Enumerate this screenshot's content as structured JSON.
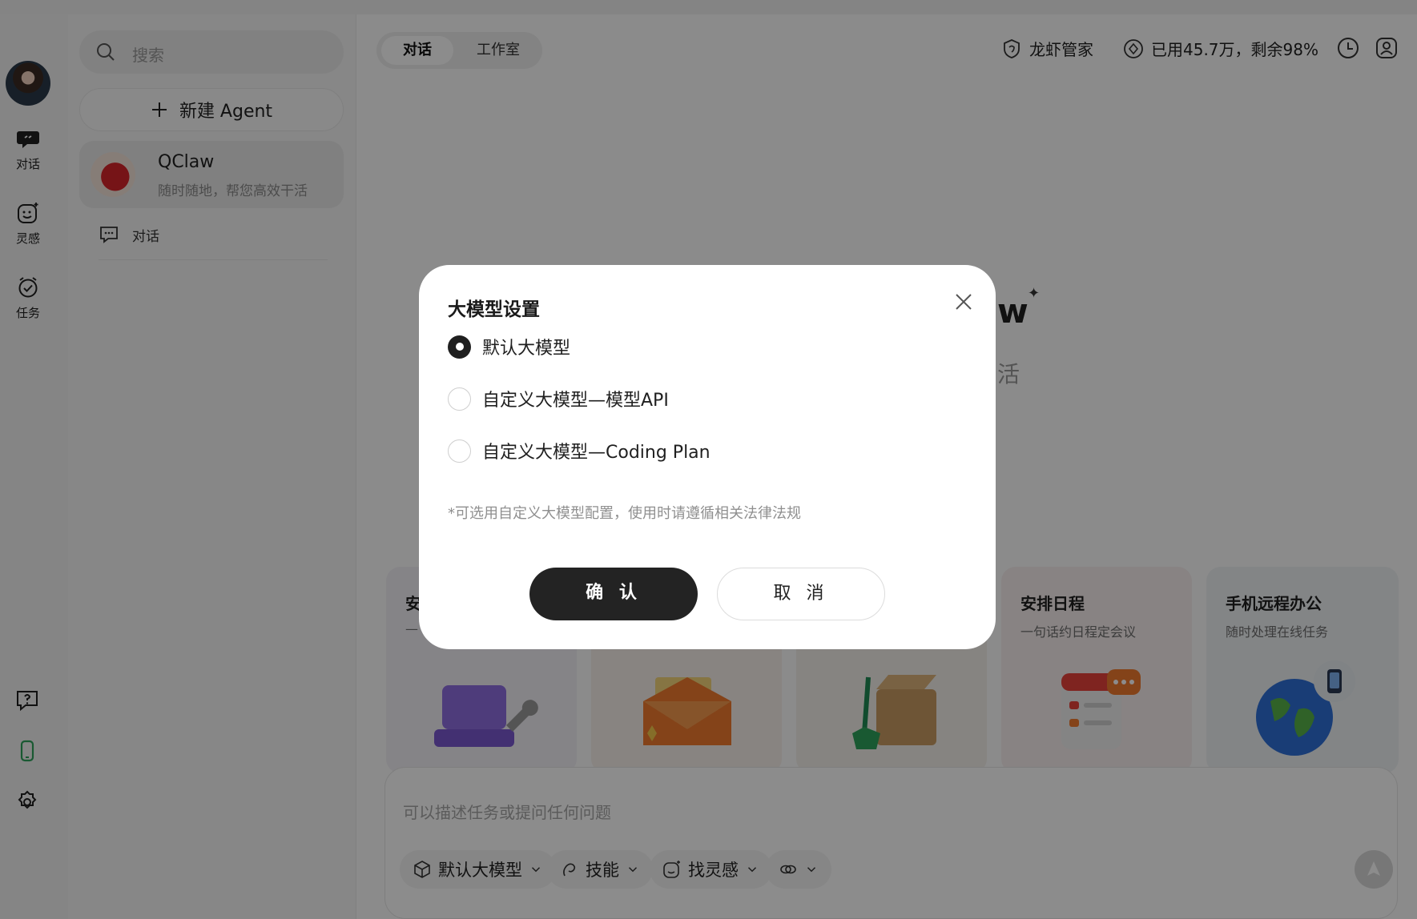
{
  "rail": {
    "items": [
      {
        "label": "对话"
      },
      {
        "label": "灵感"
      },
      {
        "label": "任务"
      }
    ]
  },
  "sidebar": {
    "search_placeholder": "搜索",
    "new_agent_label": "新建 Agent",
    "agent": {
      "name": "QClaw",
      "description": "随时随地，帮您高效干活"
    },
    "conversation_label": "对话"
  },
  "main": {
    "tabs": [
      {
        "label": "对话"
      },
      {
        "label": "工作室"
      }
    ],
    "header": {
      "assistant_label": "龙虾管家",
      "usage_label": "已用45.7万，剩余98%"
    },
    "hero": {
      "title_fragment": "w",
      "subtitle_fragment": "活"
    },
    "cards": [
      {
        "title": "安",
        "subtitle": "—"
      },
      {
        "title": "",
        "subtitle": ""
      },
      {
        "title": "",
        "subtitle": ""
      },
      {
        "title": "安排日程",
        "subtitle": "一句话约日程定会议"
      },
      {
        "title": "手机远程办公",
        "subtitle": "随时处理在线任务"
      }
    ],
    "composer": {
      "placeholder": "可以描述任务或提问任何问题",
      "chips": [
        {
          "label": "默认大模型"
        },
        {
          "label": "技能"
        },
        {
          "label": "找灵感"
        },
        {
          "label": ""
        }
      ]
    }
  },
  "modal": {
    "title": "大模型设置",
    "options": [
      {
        "label": "默认大模型",
        "selected": true
      },
      {
        "label": "自定义大模型—模型API",
        "selected": false
      },
      {
        "label": "自定义大模型—Coding Plan",
        "selected": false
      }
    ],
    "note": "*可选用自定义大模型配置，使用时请遵循相关法律法规",
    "confirm_label": "确 认",
    "cancel_label": "取 消"
  },
  "colors": {
    "accent_dark": "#232323",
    "overlay": "rgba(0,0,0,0.45)",
    "phone_green": "#2fa35b"
  }
}
